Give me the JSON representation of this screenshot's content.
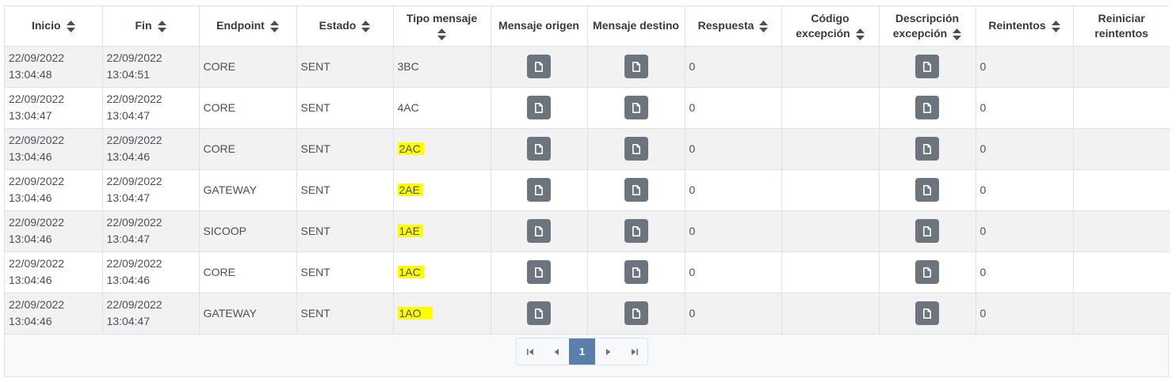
{
  "table": {
    "headers": {
      "inicio": "Inicio",
      "fin": "Fin",
      "endpoint": "Endpoint",
      "estado": "Estado",
      "tipo_mensaje": "Tipo mensaje",
      "mensaje_origen": "Mensaje origen",
      "mensaje_destino": "Mensaje destino",
      "respuesta": "Respuesta",
      "codigo_excepcion_1": "Código",
      "codigo_excepcion_2": "excepción",
      "descripcion_excepcion_1": "Descripción",
      "descripcion_excepcion_2": "excepción",
      "reintentos": "Reintentos",
      "reiniciar_1": "Reiniciar",
      "reiniciar_2": "reintentos"
    },
    "rows": [
      {
        "inicio_date": "22/09/2022",
        "inicio_time": "13:04:48",
        "fin_date": "22/09/2022",
        "fin_time": "13:04:51",
        "endpoint": "CORE",
        "estado": "SENT",
        "tipo": "3BC",
        "respuesta": "0",
        "codigo": "",
        "reintentos": "0"
      },
      {
        "inicio_date": "22/09/2022",
        "inicio_time": "13:04:47",
        "fin_date": "22/09/2022",
        "fin_time": "13:04:47",
        "endpoint": "CORE",
        "estado": "SENT",
        "tipo": "4AC",
        "respuesta": "0",
        "codigo": "",
        "reintentos": "0"
      },
      {
        "inicio_date": "22/09/2022",
        "inicio_time": "13:04:46",
        "fin_date": "22/09/2022",
        "fin_time": "13:04:46",
        "endpoint": "CORE",
        "estado": "SENT",
        "tipo": "2AC",
        "respuesta": "0",
        "codigo": "",
        "reintentos": "0"
      },
      {
        "inicio_date": "22/09/2022",
        "inicio_time": "13:04:46",
        "fin_date": "22/09/2022",
        "fin_time": "13:04:47",
        "endpoint": "GATEWAY",
        "estado": "SENT",
        "tipo": "2AE",
        "respuesta": "0",
        "codigo": "",
        "reintentos": "0"
      },
      {
        "inicio_date": "22/09/2022",
        "inicio_time": "13:04:46",
        "fin_date": "22/09/2022",
        "fin_time": "13:04:47",
        "endpoint": "SICOOP",
        "estado": "SENT",
        "tipo": "1AE",
        "respuesta": "0",
        "codigo": "",
        "reintentos": "0"
      },
      {
        "inicio_date": "22/09/2022",
        "inicio_time": "13:04:46",
        "fin_date": "22/09/2022",
        "fin_time": "13:04:46",
        "endpoint": "CORE",
        "estado": "SENT",
        "tipo": "1AC",
        "respuesta": "0",
        "codigo": "",
        "reintentos": "0"
      },
      {
        "inicio_date": "22/09/2022",
        "inicio_time": "13:04:46",
        "fin_date": "22/09/2022",
        "fin_time": "13:04:47",
        "endpoint": "GATEWAY",
        "estado": "SENT",
        "tipo": "1AO",
        "respuesta": "0",
        "codigo": "",
        "reintentos": "0"
      }
    ]
  },
  "pagination": {
    "current_page": "1"
  },
  "colors": {
    "button": "#6c757d",
    "highlight": "#ffff00",
    "active_page": "#5a7fab",
    "row_stripe": "#f2f2f2"
  }
}
